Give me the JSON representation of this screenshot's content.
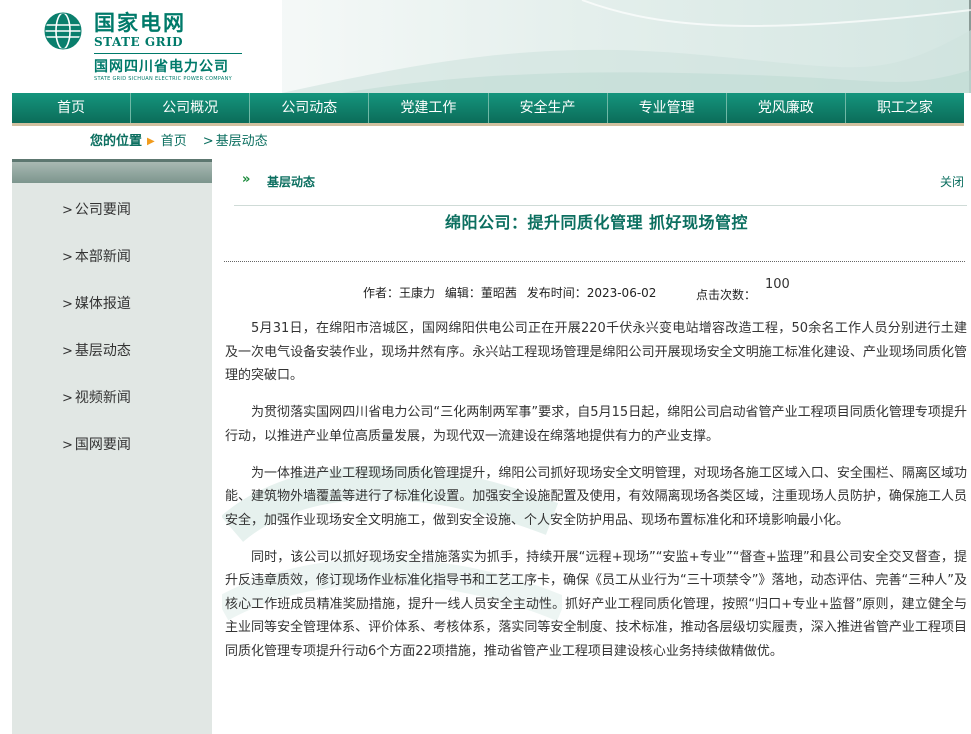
{
  "logo": {
    "name_cn": "国家电网",
    "name_en": "STATE GRID",
    "company_cn": "国网四川省电力公司",
    "company_en": "STATE GRID SICHUAN ELECTRIC POWER COMPANY"
  },
  "nav": [
    "首页",
    "公司概况",
    "公司动态",
    "党建工作",
    "安全生产",
    "专业管理",
    "党风廉政",
    "职工之家"
  ],
  "breadcrumb": {
    "label": "您的位置",
    "home": "首页",
    "current": "基层动态"
  },
  "sidebar": {
    "items": [
      "公司要闻",
      "本部新闻",
      "媒体报道",
      "基层动态",
      "视频新闻",
      "国网要闻"
    ]
  },
  "section": {
    "title": "基层动态",
    "close": "关闭"
  },
  "article": {
    "title": "绵阳公司：提升同质化管理 抓好现场管控",
    "author": "作者：王康力",
    "editor": "编辑：董昭茜",
    "date": "发布时间：2023-06-02",
    "clicks_label": "点击次数：",
    "clicks": "100",
    "paragraphs": [
      "5月31日，在绵阳市涪城区，国网绵阳供电公司正在开展220千伏永兴变电站增容改造工程，50余名工作人员分别进行土建及一次电气设备安装作业，现场井然有序。永兴站工程现场管理是绵阳公司开展现场安全文明施工标准化建设、产业现场同质化管理的突破口。",
      "为贯彻落实国网四川省电力公司“三化两制两军事”要求，自5月15日起，绵阳公司启动省管产业工程项目同质化管理专项提升行动，以推进产业单位高质量发展，为现代双一流建设在绵落地提供有力的产业支撑。",
      "为一体推进产业工程现场同质化管理提升，绵阳公司抓好现场安全文明管理，对现场各施工区域入口、安全围栏、隔离区域功能、建筑物外墙覆盖等进行了标准化设置。加强安全设施配置及使用，有效隔离现场各类区域，注重现场人员防护，确保施工人员安全，加强作业现场安全文明施工，做到安全设施、个人安全防护用品、现场布置标准化和环境影响最小化。",
      "同时，该公司以抓好现场安全措施落实为抓手，持续开展“远程+现场”“安监+专业”“督查+监理”和县公司安全交叉督查，提升反违章质效，修订现场作业标准化指导书和工艺工序卡，确保《员工从业行为“三十项禁令”》落地，动态评估、完善“三种人”及核心工作班成员精准奖励措施，提升一线人员安全主动性。抓好产业工程同质化管理，按照“归口+专业+监督”原则，建立健全与主业同等安全管理体系、评价体系、考核体系，落实同等安全制度、技术标准，推动各层级切实履责，深入推进省管产业工程项目同质化管理专项提升行动6个方面22项措施，推动省管产业工程项目建设核心业务持续做精做优。"
    ]
  },
  "colors": {
    "brand_green": "#0c6f60",
    "nav_green": "#0f7a66",
    "accent_orange": "#f19b1c"
  }
}
